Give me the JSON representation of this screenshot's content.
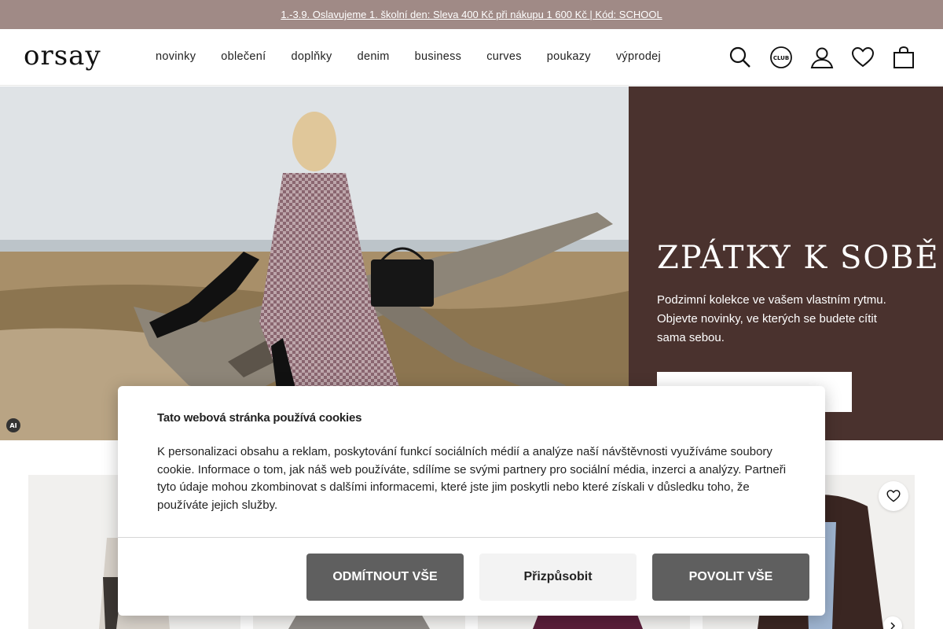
{
  "promo": {
    "text": "1.-3.9. Oslavujeme 1. školní den: Sleva 400 Kč při nákupu 1 600 Kč | Kód: SCHOOL"
  },
  "header": {
    "logo": "orsay",
    "nav": [
      "novinky",
      "oblečení",
      "doplňky",
      "denim",
      "business",
      "curves",
      "poukazy",
      "výprodej"
    ],
    "icons": [
      "search-icon",
      "club-icon",
      "account-icon",
      "wishlist-icon",
      "bag-icon"
    ],
    "club_label": "CLUB"
  },
  "hero": {
    "title": "ZPÁTKY K SOBĚ",
    "text": "Podzimní kolekce ve vašem vlastním rytmu. Objevte novinky, ve kterých se budete cítit sama sebou.",
    "ai_badge": "AI"
  },
  "cookie": {
    "title": "Tato webová stránka používá cookies",
    "body": "K personalizaci obsahu a reklam, poskytování funkcí sociálních médií a analýze naší návštěvnosti využíváme soubory cookie. Informace o tom, jak náš web používáte, sdílíme se svými partnery pro sociální média, inzerci a analýzy. Partneři tyto údaje mohou zkombinovat s dalšími informacemi, které jste jim poskytli nebo které získali v důsledku toho, že používáte jejich služby.",
    "reject_label": "ODMÍTNOUT VŠE",
    "customize_label": "Přizpůsobit",
    "accept_label": "POVOLIT VŠE"
  },
  "colors": {
    "promo_bg": "#a08a86",
    "hero_panel_bg": "#4a322e",
    "button_dark": "#5f5f5f"
  }
}
